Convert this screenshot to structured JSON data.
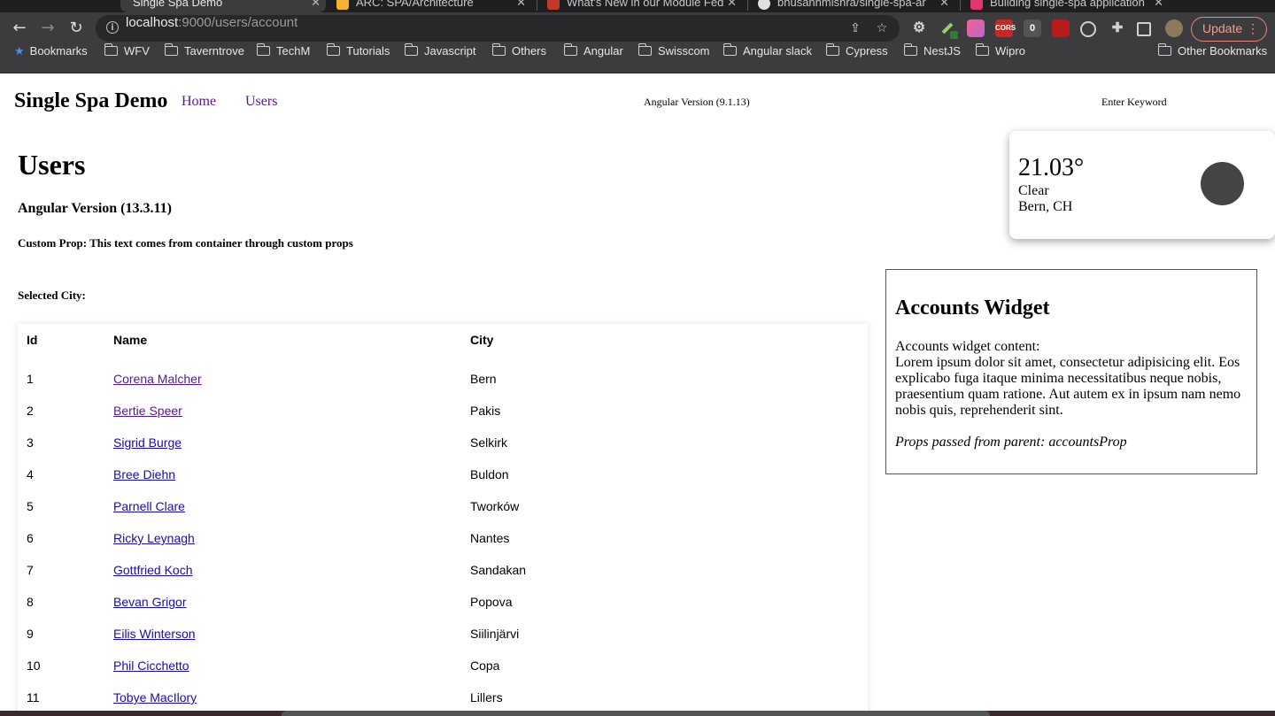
{
  "browser": {
    "tabs": [
      {
        "title": "Single Spa Demo",
        "active": true
      },
      {
        "title": "ARC: SPA/Architecture"
      },
      {
        "title": "What's New in our Module Fed"
      },
      {
        "title": "bhusanhmishra/single-spa-ar"
      },
      {
        "title": "Building single-spa application"
      }
    ],
    "url_host": "localhost",
    "url_path": ":9000/users/account",
    "update_label": "Update",
    "ext_labels": {
      "cors": "CORS",
      "zero": "0"
    },
    "bookmarks": [
      {
        "label": "Bookmarks",
        "icon": "star-icon"
      },
      {
        "label": "WFV",
        "icon": "folder-icon"
      },
      {
        "label": "Taverntrove",
        "icon": "folder-icon"
      },
      {
        "label": "TechM",
        "icon": "folder-icon"
      },
      {
        "label": "Tutorials",
        "icon": "folder-icon"
      },
      {
        "label": "Javascript",
        "icon": "folder-icon"
      },
      {
        "label": "Others",
        "icon": "folder-icon"
      },
      {
        "label": "Angular",
        "icon": "folder-icon"
      },
      {
        "label": "Swisscom",
        "icon": "folder-icon"
      },
      {
        "label": "Angular slack",
        "icon": "folder-icon"
      },
      {
        "label": "Cypress",
        "icon": "folder-icon"
      },
      {
        "label": "NestJS",
        "icon": "folder-icon"
      },
      {
        "label": "Wipro",
        "icon": "folder-icon"
      }
    ],
    "other_bookmarks": "Other Bookmarks"
  },
  "header": {
    "brand": "Single Spa Demo",
    "nav": [
      "Home",
      "Users"
    ],
    "version": "Angular Version (9.1.13)",
    "keyword": "Enter Keyword"
  },
  "weather": {
    "temp": "21.03°",
    "condition": "Clear",
    "location": "Bern, CH"
  },
  "users": {
    "title": "Users",
    "version": "Angular Version (13.3.11)",
    "custom_prop": "Custom Prop: This text comes from container through custom props",
    "selected_city": "Selected City:",
    "columns": [
      "Id",
      "Name",
      "City"
    ],
    "rows": [
      {
        "id": "1",
        "name": "Corena Malcher",
        "city": "Bern",
        "visited": true
      },
      {
        "id": "2",
        "name": "Bertie Speer",
        "city": "Pakis",
        "visited": true
      },
      {
        "id": "3",
        "name": "Sigrid Burge",
        "city": "Selkirk"
      },
      {
        "id": "4",
        "name": "Bree Diehn",
        "city": "Buldon"
      },
      {
        "id": "5",
        "name": "Parnell Clare",
        "city": "Tworków"
      },
      {
        "id": "6",
        "name": "Ricky Leynagh",
        "city": "Nantes"
      },
      {
        "id": "7",
        "name": "Gottfried Koch",
        "city": "Sandakan"
      },
      {
        "id": "8",
        "name": "Bevan Grigor",
        "city": "Popova"
      },
      {
        "id": "9",
        "name": "Eilis Winterson",
        "city": "Siilinjärvi"
      },
      {
        "id": "10",
        "name": "Phil Cicchetto",
        "city": "Copa"
      },
      {
        "id": "11",
        "name": "Tobye MacIlory",
        "city": "Lillers"
      }
    ]
  },
  "accounts_widget": {
    "title": "Accounts Widget",
    "content_label": "Accounts widget content:",
    "content": "Lorem ipsum dolor sit amet, consectetur adipisicing elit. Eos explicabo fuga itaque minima necessitatibus neque nobis, praesentium quam ratione. Aut autem ex in ipsum nam nemo nobis quis, reprehenderit sint.",
    "props": "Props passed from parent: accountsProp"
  }
}
